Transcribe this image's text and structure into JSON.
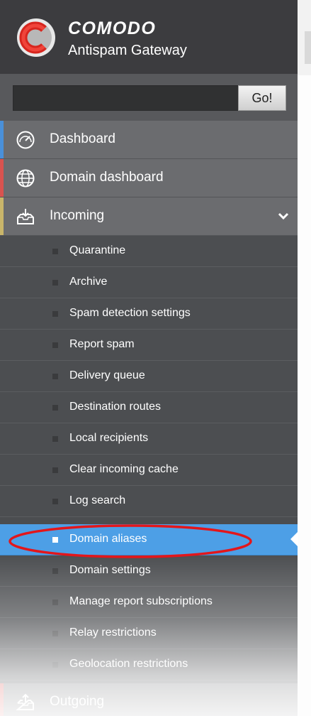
{
  "app": {
    "brand": "COMODO",
    "product": "Antispam Gateway"
  },
  "search": {
    "placeholder": "",
    "go_label": "Go!"
  },
  "nav": {
    "dashboard": "Dashboard",
    "domain_dashboard": "Domain dashboard",
    "incoming": "Incoming",
    "outgoing": "Outgoing"
  },
  "incoming_items": [
    "Quarantine",
    "Archive",
    "Spam detection settings",
    "Report spam",
    "Delivery queue",
    "Destination routes",
    "Local recipients",
    "Clear incoming cache",
    "Log search",
    "Domain aliases",
    "Domain settings",
    "Manage report subscriptions",
    "Relay restrictions",
    "Geolocation restrictions"
  ],
  "active_item": "Domain aliases",
  "colors": {
    "active": "#4d9fe6",
    "highlight_ring": "#e3161b",
    "accent_dashboard": "#4a90d9",
    "accent_domain_dashboard": "#d9534f",
    "accent_incoming": "#c9b56a",
    "accent_outgoing": "#d9534f",
    "sidebar_bg": "#4b4d50"
  }
}
